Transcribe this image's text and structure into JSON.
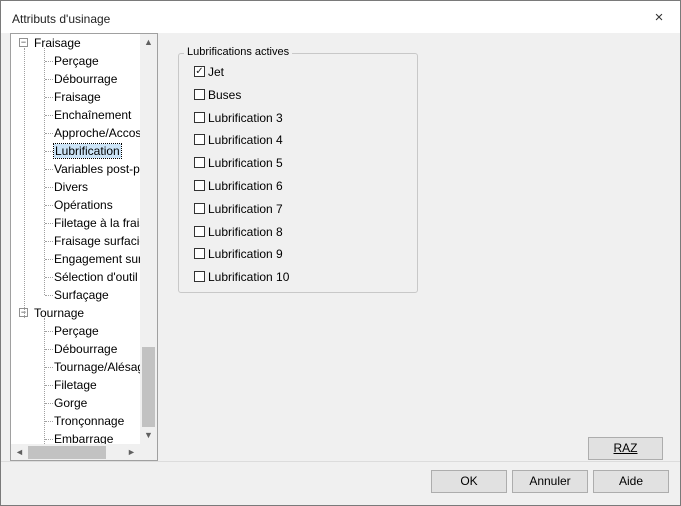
{
  "window": {
    "title": "Attributs d'usinage",
    "close_glyph": "×"
  },
  "tree": {
    "parents": [
      {
        "label": "Fraisage",
        "expander": "−",
        "children": [
          "Perçage",
          "Débourrage",
          "Fraisage",
          "Enchaînement",
          "Approche/Accos",
          "Lubrification",
          "Variables post-p",
          "Divers",
          "Opérations",
          "Filetage à la frais",
          "Fraisage surfacic",
          "Engagement sur",
          "Sélection d'outil",
          "Surfaçage"
        ]
      },
      {
        "label": "Tournage",
        "expander": "−",
        "children": [
          "Perçage",
          "Débourrage",
          "Tournage/Alésag",
          "Filetage",
          "Gorge",
          "Tronçonnage",
          "Embarrage"
        ]
      }
    ],
    "selected": "Lubrification",
    "scroll_up_icon": "▲",
    "scroll_down_icon": "▼",
    "scroll_left_icon": "◄",
    "scroll_right_icon": "►"
  },
  "lubrifications": {
    "group_title": "Lubrifications actives",
    "items": [
      {
        "label": "Jet",
        "checked": true
      },
      {
        "label": "Buses",
        "checked": false
      },
      {
        "label": "Lubrification 3",
        "checked": false
      },
      {
        "label": "Lubrification 4",
        "checked": false
      },
      {
        "label": "Lubrification 5",
        "checked": false
      },
      {
        "label": "Lubrification 6",
        "checked": false
      },
      {
        "label": "Lubrification 7",
        "checked": false
      },
      {
        "label": "Lubrification 8",
        "checked": false
      },
      {
        "label": "Lubrification 9",
        "checked": false
      },
      {
        "label": "Lubrification 10",
        "checked": false
      }
    ],
    "check_glyph": "✓"
  },
  "buttons": {
    "raz": "RAZ",
    "ok": "OK",
    "cancel": "Annuler",
    "help": "Aide"
  }
}
